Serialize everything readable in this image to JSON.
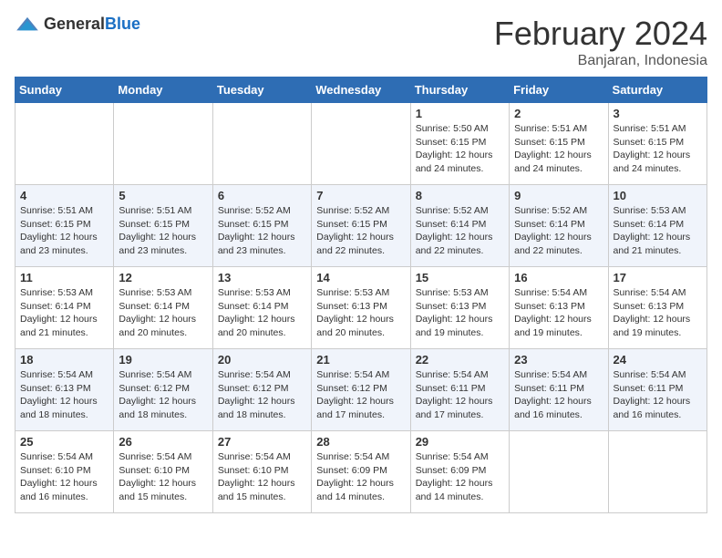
{
  "header": {
    "logo_general": "General",
    "logo_blue": "Blue",
    "title": "February 2024",
    "subtitle": "Banjaran, Indonesia"
  },
  "days_of_week": [
    "Sunday",
    "Monday",
    "Tuesday",
    "Wednesday",
    "Thursday",
    "Friday",
    "Saturday"
  ],
  "weeks": [
    [
      {
        "day": "",
        "info": ""
      },
      {
        "day": "",
        "info": ""
      },
      {
        "day": "",
        "info": ""
      },
      {
        "day": "",
        "info": ""
      },
      {
        "day": "1",
        "info": "Sunrise: 5:50 AM\nSunset: 6:15 PM\nDaylight: 12 hours and 24 minutes."
      },
      {
        "day": "2",
        "info": "Sunrise: 5:51 AM\nSunset: 6:15 PM\nDaylight: 12 hours and 24 minutes."
      },
      {
        "day": "3",
        "info": "Sunrise: 5:51 AM\nSunset: 6:15 PM\nDaylight: 12 hours and 24 minutes."
      }
    ],
    [
      {
        "day": "4",
        "info": "Sunrise: 5:51 AM\nSunset: 6:15 PM\nDaylight: 12 hours and 23 minutes."
      },
      {
        "day": "5",
        "info": "Sunrise: 5:51 AM\nSunset: 6:15 PM\nDaylight: 12 hours and 23 minutes."
      },
      {
        "day": "6",
        "info": "Sunrise: 5:52 AM\nSunset: 6:15 PM\nDaylight: 12 hours and 23 minutes."
      },
      {
        "day": "7",
        "info": "Sunrise: 5:52 AM\nSunset: 6:15 PM\nDaylight: 12 hours and 22 minutes."
      },
      {
        "day": "8",
        "info": "Sunrise: 5:52 AM\nSunset: 6:14 PM\nDaylight: 12 hours and 22 minutes."
      },
      {
        "day": "9",
        "info": "Sunrise: 5:52 AM\nSunset: 6:14 PM\nDaylight: 12 hours and 22 minutes."
      },
      {
        "day": "10",
        "info": "Sunrise: 5:53 AM\nSunset: 6:14 PM\nDaylight: 12 hours and 21 minutes."
      }
    ],
    [
      {
        "day": "11",
        "info": "Sunrise: 5:53 AM\nSunset: 6:14 PM\nDaylight: 12 hours and 21 minutes."
      },
      {
        "day": "12",
        "info": "Sunrise: 5:53 AM\nSunset: 6:14 PM\nDaylight: 12 hours and 20 minutes."
      },
      {
        "day": "13",
        "info": "Sunrise: 5:53 AM\nSunset: 6:14 PM\nDaylight: 12 hours and 20 minutes."
      },
      {
        "day": "14",
        "info": "Sunrise: 5:53 AM\nSunset: 6:13 PM\nDaylight: 12 hours and 20 minutes."
      },
      {
        "day": "15",
        "info": "Sunrise: 5:53 AM\nSunset: 6:13 PM\nDaylight: 12 hours and 19 minutes."
      },
      {
        "day": "16",
        "info": "Sunrise: 5:54 AM\nSunset: 6:13 PM\nDaylight: 12 hours and 19 minutes."
      },
      {
        "day": "17",
        "info": "Sunrise: 5:54 AM\nSunset: 6:13 PM\nDaylight: 12 hours and 19 minutes."
      }
    ],
    [
      {
        "day": "18",
        "info": "Sunrise: 5:54 AM\nSunset: 6:13 PM\nDaylight: 12 hours and 18 minutes."
      },
      {
        "day": "19",
        "info": "Sunrise: 5:54 AM\nSunset: 6:12 PM\nDaylight: 12 hours and 18 minutes."
      },
      {
        "day": "20",
        "info": "Sunrise: 5:54 AM\nSunset: 6:12 PM\nDaylight: 12 hours and 18 minutes."
      },
      {
        "day": "21",
        "info": "Sunrise: 5:54 AM\nSunset: 6:12 PM\nDaylight: 12 hours and 17 minutes."
      },
      {
        "day": "22",
        "info": "Sunrise: 5:54 AM\nSunset: 6:11 PM\nDaylight: 12 hours and 17 minutes."
      },
      {
        "day": "23",
        "info": "Sunrise: 5:54 AM\nSunset: 6:11 PM\nDaylight: 12 hours and 16 minutes."
      },
      {
        "day": "24",
        "info": "Sunrise: 5:54 AM\nSunset: 6:11 PM\nDaylight: 12 hours and 16 minutes."
      }
    ],
    [
      {
        "day": "25",
        "info": "Sunrise: 5:54 AM\nSunset: 6:10 PM\nDaylight: 12 hours and 16 minutes."
      },
      {
        "day": "26",
        "info": "Sunrise: 5:54 AM\nSunset: 6:10 PM\nDaylight: 12 hours and 15 minutes."
      },
      {
        "day": "27",
        "info": "Sunrise: 5:54 AM\nSunset: 6:10 PM\nDaylight: 12 hours and 15 minutes."
      },
      {
        "day": "28",
        "info": "Sunrise: 5:54 AM\nSunset: 6:09 PM\nDaylight: 12 hours and 14 minutes."
      },
      {
        "day": "29",
        "info": "Sunrise: 5:54 AM\nSunset: 6:09 PM\nDaylight: 12 hours and 14 minutes."
      },
      {
        "day": "",
        "info": ""
      },
      {
        "day": "",
        "info": ""
      }
    ]
  ]
}
